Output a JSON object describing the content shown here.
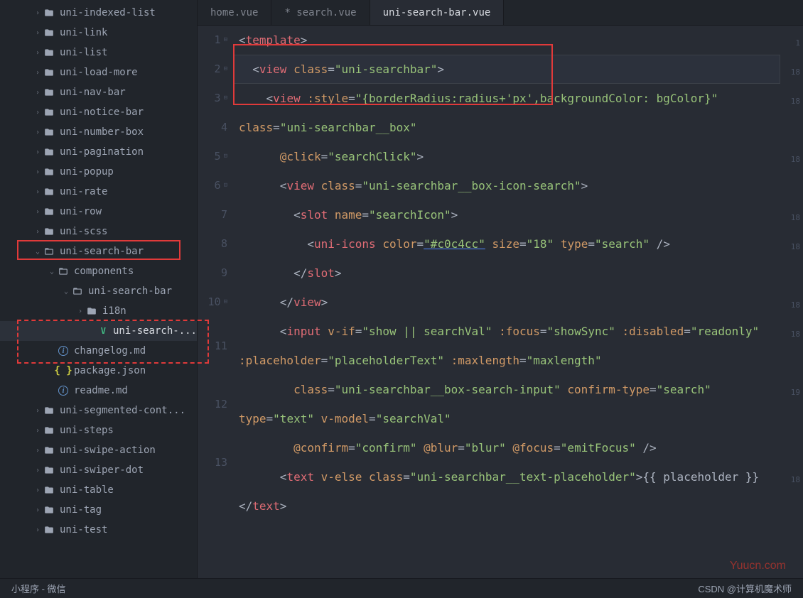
{
  "tabs": [
    {
      "label": "home.vue",
      "active": false
    },
    {
      "label": "* search.vue",
      "active": false
    },
    {
      "label": "uni-search-bar.vue",
      "active": true
    }
  ],
  "sidebar": {
    "items": [
      {
        "label": "uni-indexed-list",
        "type": "folder",
        "indent": 1
      },
      {
        "label": "uni-link",
        "type": "folder",
        "indent": 1
      },
      {
        "label": "uni-list",
        "type": "folder",
        "indent": 1
      },
      {
        "label": "uni-load-more",
        "type": "folder",
        "indent": 1
      },
      {
        "label": "uni-nav-bar",
        "type": "folder",
        "indent": 1
      },
      {
        "label": "uni-notice-bar",
        "type": "folder",
        "indent": 1
      },
      {
        "label": "uni-number-box",
        "type": "folder",
        "indent": 1
      },
      {
        "label": "uni-pagination",
        "type": "folder",
        "indent": 1
      },
      {
        "label": "uni-popup",
        "type": "folder",
        "indent": 1
      },
      {
        "label": "uni-rate",
        "type": "folder",
        "indent": 1
      },
      {
        "label": "uni-row",
        "type": "folder",
        "indent": 1
      },
      {
        "label": "uni-scss",
        "type": "folder",
        "indent": 1
      },
      {
        "label": "uni-search-bar",
        "type": "folder-open",
        "indent": 1
      },
      {
        "label": "components",
        "type": "folder-open",
        "indent": 2
      },
      {
        "label": "uni-search-bar",
        "type": "folder-open",
        "indent": 3
      },
      {
        "label": "i18n",
        "type": "folder",
        "indent": 4
      },
      {
        "label": "uni-search-...",
        "type": "vue",
        "indent": 5,
        "active": true
      },
      {
        "label": "changelog.md",
        "type": "md",
        "indent": 2
      },
      {
        "label": "package.json",
        "type": "json",
        "indent": 2
      },
      {
        "label": "readme.md",
        "type": "md",
        "indent": 2
      },
      {
        "label": "uni-segmented-cont...",
        "type": "folder",
        "indent": 1
      },
      {
        "label": "uni-steps",
        "type": "folder",
        "indent": 1
      },
      {
        "label": "uni-swipe-action",
        "type": "folder",
        "indent": 1
      },
      {
        "label": "uni-swiper-dot",
        "type": "folder",
        "indent": 1
      },
      {
        "label": "uni-table",
        "type": "folder",
        "indent": 1
      },
      {
        "label": "uni-tag",
        "type": "folder",
        "indent": 1
      },
      {
        "label": "uni-test",
        "type": "folder",
        "indent": 1
      }
    ]
  },
  "code": {
    "line1": {
      "open": "<",
      "tag": "template",
      "close": ">"
    },
    "line2": {
      "open": "<",
      "tag": "view",
      "attr": "class",
      "eq": "=",
      "val": "\"uni-searchbar\"",
      "close": ">"
    },
    "line3": {
      "pre": "    ",
      "open": "<",
      "tag": "view",
      "attr1": ":style",
      "eq": "=",
      "val1": "\"{borderRadius:radius+'px',backgroundColor: bgColor}\"",
      "attr2": "class",
      "val2": "\"uni-searchbar__box\""
    },
    "line4": {
      "pre": "      ",
      "attr": "@click",
      "eq": "=",
      "val": "\"searchClick\"",
      "close": ">"
    },
    "line5": {
      "pre": "      ",
      "open": "<",
      "tag": "view",
      "attr": "class",
      "eq": "=",
      "val": "\"uni-searchbar__box-icon-search\"",
      "close": ">"
    },
    "line6": {
      "pre": "        ",
      "open": "<",
      "tag": "slot",
      "attr": "name",
      "eq": "=",
      "val": "\"searchIcon\"",
      "close": ">"
    },
    "line7": {
      "pre": "          ",
      "open": "<",
      "tag": "uni-icons",
      "attr1": "color",
      "eq": "=",
      "val1": "\"#c0c4cc\"",
      "attr2": "size",
      "val2": "\"18\"",
      "attr3": "type",
      "val3": "\"search\"",
      "close": " />"
    },
    "line8": {
      "pre": "        ",
      "open": "</",
      "tag": "slot",
      "close": ">"
    },
    "line9": {
      "pre": "      ",
      "open": "</",
      "tag": "view",
      "close": ">"
    },
    "line10": {
      "pre": "      ",
      "open": "<",
      "tag": "input",
      "attrs": "v-if=\"show || searchVal\" :focus=\"showSync\" :disabled=\"readonly\" :placeholder=\"placeholderText\" :maxlength=\"maxlength\""
    },
    "line11": {
      "pre": "        ",
      "text": "class=\"uni-searchbar__box-search-input\" confirm-type=\"search\" type=\"text\" v-model=\"searchVal\""
    },
    "line12": {
      "pre": "        ",
      "text": "@confirm=\"confirm\" @blur=\"blur\" @focus=\"emitFocus\" />"
    },
    "line13": {
      "pre": "      ",
      "open": "<",
      "tag": "text",
      "attrs": "v-else class=\"uni-searchbar__text-placeholder\"",
      "close": ">",
      "txt": "{{ placeholder }}",
      "copen": "</",
      "ctag": "text",
      "cclose": ">"
    }
  },
  "rightGutter": [
    "1",
    "18",
    "18",
    "18",
    "",
    "18",
    "18",
    "",
    "18",
    "18",
    "19",
    "",
    "18"
  ],
  "statusbar": {
    "left": "小程序 - 微信",
    "right": "CSDN @计算机魔术师"
  },
  "watermark": "Yuucn.com"
}
